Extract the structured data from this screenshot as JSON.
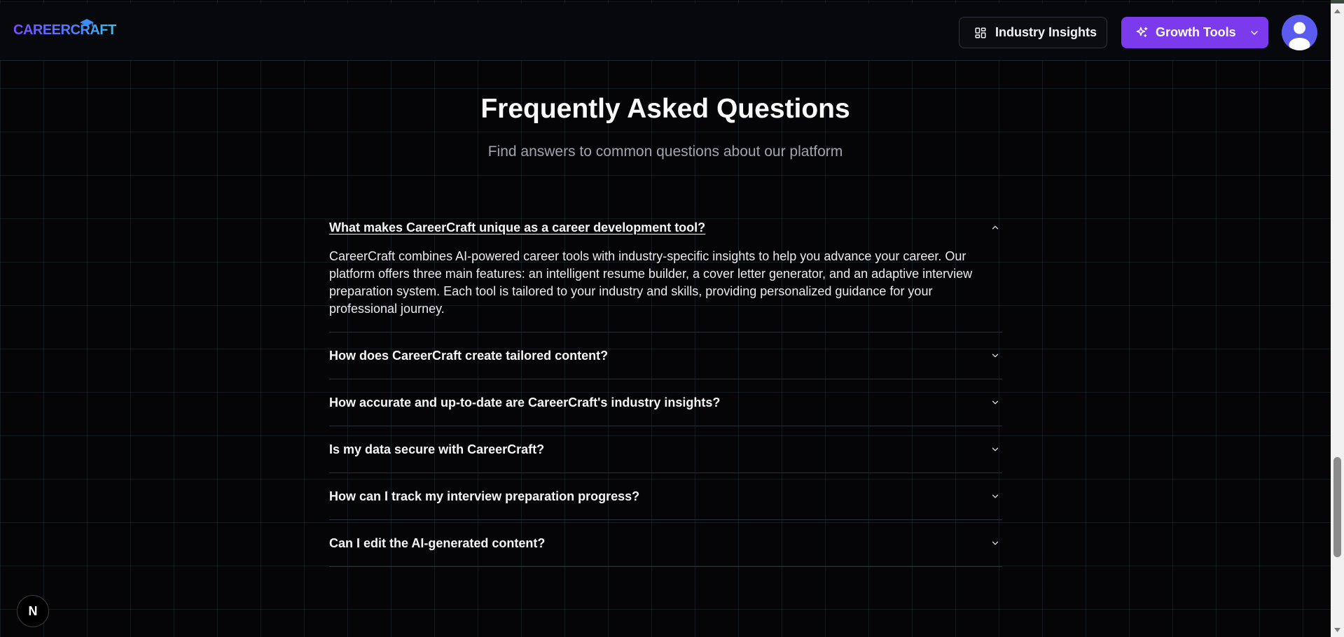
{
  "header": {
    "logo_text": "CAREERCRAFT",
    "insights_label": "Industry Insights",
    "growth_label": "Growth Tools"
  },
  "faq": {
    "title": "Frequently Asked Questions",
    "subtitle": "Find answers to common questions about our platform",
    "items": [
      {
        "question": "What makes CareerCraft unique as a career development tool?",
        "answer": "CareerCraft combines AI-powered career tools with industry-specific insights to help you advance your career. Our platform offers three main features: an intelligent resume builder, a cover letter generator, and an adaptive interview preparation system. Each tool is tailored to your industry and skills, providing personalized guidance for your professional journey.",
        "expanded": true
      },
      {
        "question": "How does CareerCraft create tailored content?",
        "expanded": false
      },
      {
        "question": "How accurate and up-to-date are CareerCraft's industry insights?",
        "expanded": false
      },
      {
        "question": "Is my data secure with CareerCraft?",
        "expanded": false
      },
      {
        "question": "How can I track my interview preparation progress?",
        "expanded": false
      },
      {
        "question": "Can I edit the AI-generated content?",
        "expanded": false
      }
    ]
  },
  "dev_badge": {
    "label": "N"
  },
  "colors": {
    "accent": "#7c3aed",
    "background": "#050507",
    "avatar": "#5b5bf0"
  },
  "icons": {
    "insights": "layout-dashboard-icon",
    "growth": "sparkles-icon",
    "dropdown": "chevron-down-icon",
    "collapse": "chevron-up-icon",
    "avatar": "user-icon"
  }
}
